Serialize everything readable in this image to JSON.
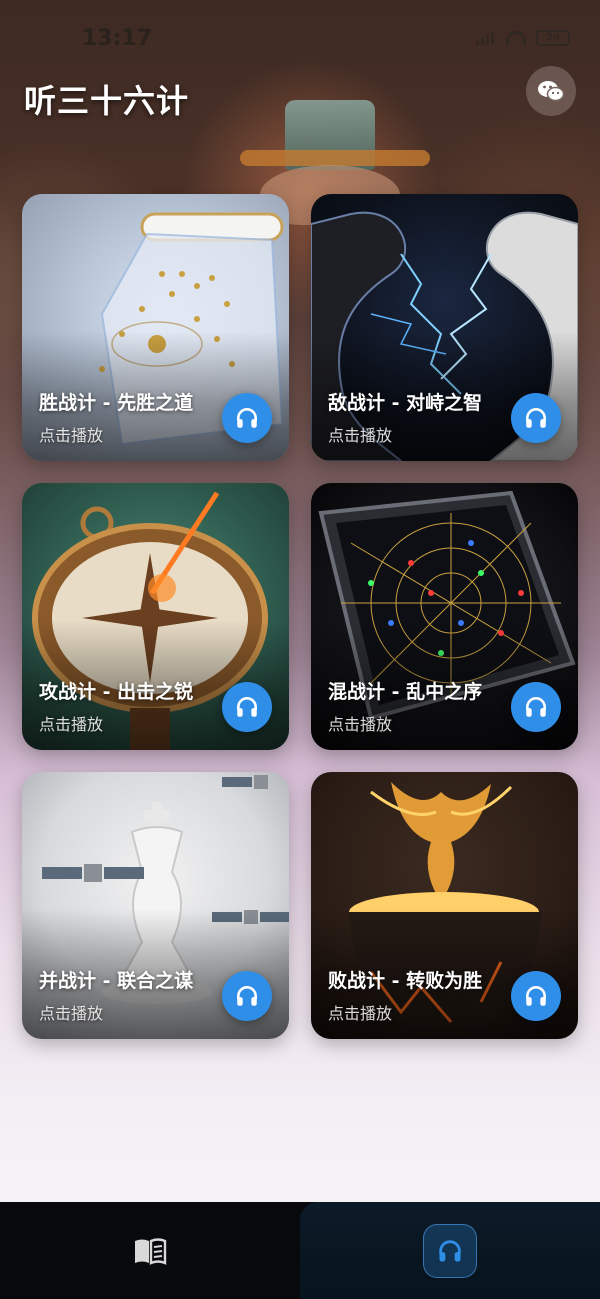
{
  "status": {
    "time": "13:17",
    "battery": "20"
  },
  "header": {
    "title": "听三十六计",
    "wechat_icon": "wechat-icon"
  },
  "cards": [
    {
      "title": "胜战计 - 先胜之道",
      "subtitle": "点击播放",
      "art": "scroll-map-with-soldiers"
    },
    {
      "title": "敌战计 - 对峙之智",
      "subtitle": "点击播放",
      "art": "black-and-white-dragons-lightning"
    },
    {
      "title": "攻战计 - 出击之锐",
      "subtitle": "点击播放",
      "art": "compass-with-flaming-arrow"
    },
    {
      "title": "混战计 - 乱中之序",
      "subtitle": "点击播放",
      "art": "radar-screen-with-dots"
    },
    {
      "title": "并战计 - 联合之谋",
      "subtitle": "点击播放",
      "art": "chess-king-with-satellites"
    },
    {
      "title": "败战计 - 转败为胜",
      "subtitle": "点击播放",
      "art": "phoenix-rising-from-bowl"
    }
  ],
  "tabbar": {
    "tabs": [
      {
        "name": "read",
        "icon": "book-icon",
        "active": false
      },
      {
        "name": "listen",
        "icon": "headphones-icon",
        "active": true
      }
    ]
  },
  "colors": {
    "accent": "#2f8ee8",
    "tabbar_bg": "#07090c"
  }
}
